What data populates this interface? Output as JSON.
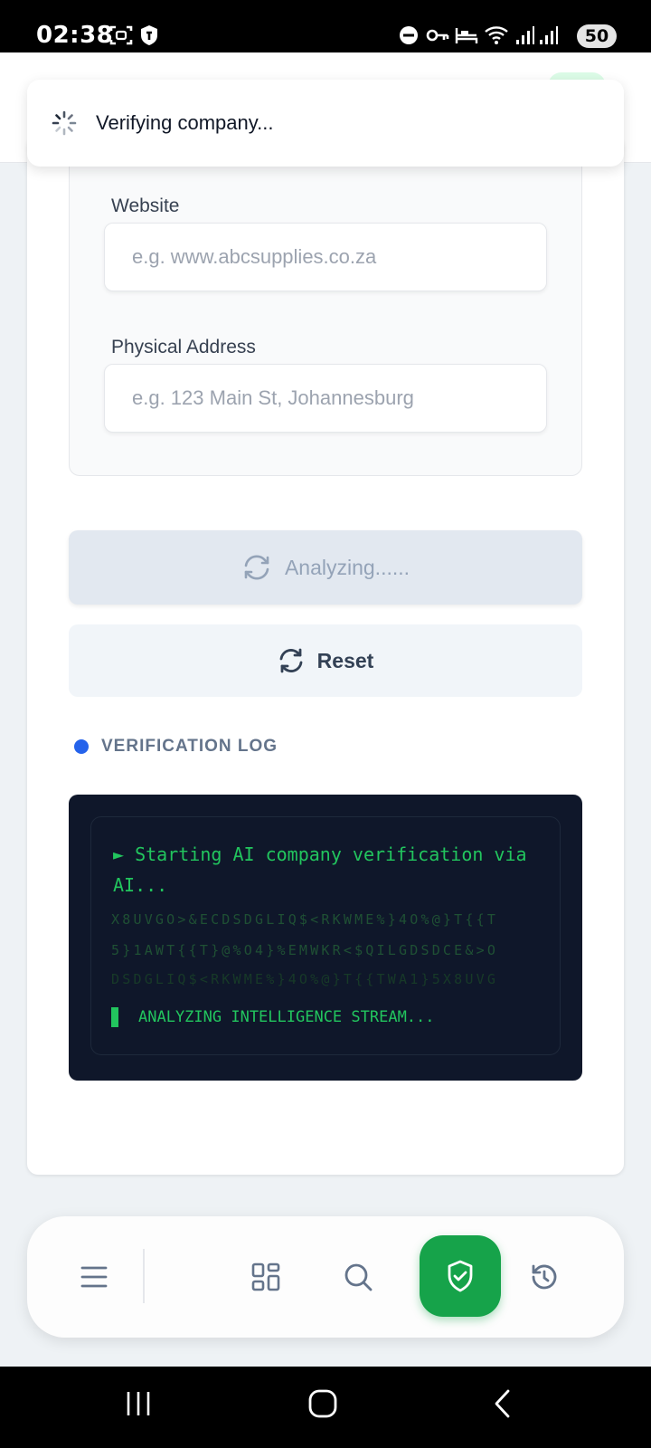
{
  "status_bar": {
    "time": "02:38",
    "battery": "50"
  },
  "toast": {
    "message": "Verifying company..."
  },
  "form": {
    "website": {
      "label": "Website",
      "placeholder": "e.g. www.abcsupplies.co.za"
    },
    "address": {
      "label": "Physical Address",
      "placeholder": "e.g. 123 Main St, Johannesburg"
    }
  },
  "buttons": {
    "analyze_label": "Analyzing......",
    "reset_label": "Reset"
  },
  "log": {
    "title": "VERIFICATION LOG",
    "line": "► Starting AI company verification via AI...",
    "noise": [
      "X8UVGO>&ECDSDGLIQ$<RKWME%}4O%@}T{{T",
      "5}1AWT{{T}@%O4}%EMWKR<$QILGDSDCE&>O",
      "DSDGLIQ$<RKWME%}4O%@}T{{TWA1}5X8UVG"
    ],
    "status": "ANALYZING INTELLIGENCE STREAM..."
  },
  "bottom_nav": {
    "items": [
      "menu-icon",
      "grid-icon",
      "search-icon",
      "shield-check-icon",
      "history-icon"
    ],
    "active": "shield-check-icon"
  },
  "colors": {
    "accent_green": "#16a34a",
    "terminal_bg": "#0f172a",
    "terminal_text": "#22c55e",
    "log_dot": "#2563eb"
  }
}
